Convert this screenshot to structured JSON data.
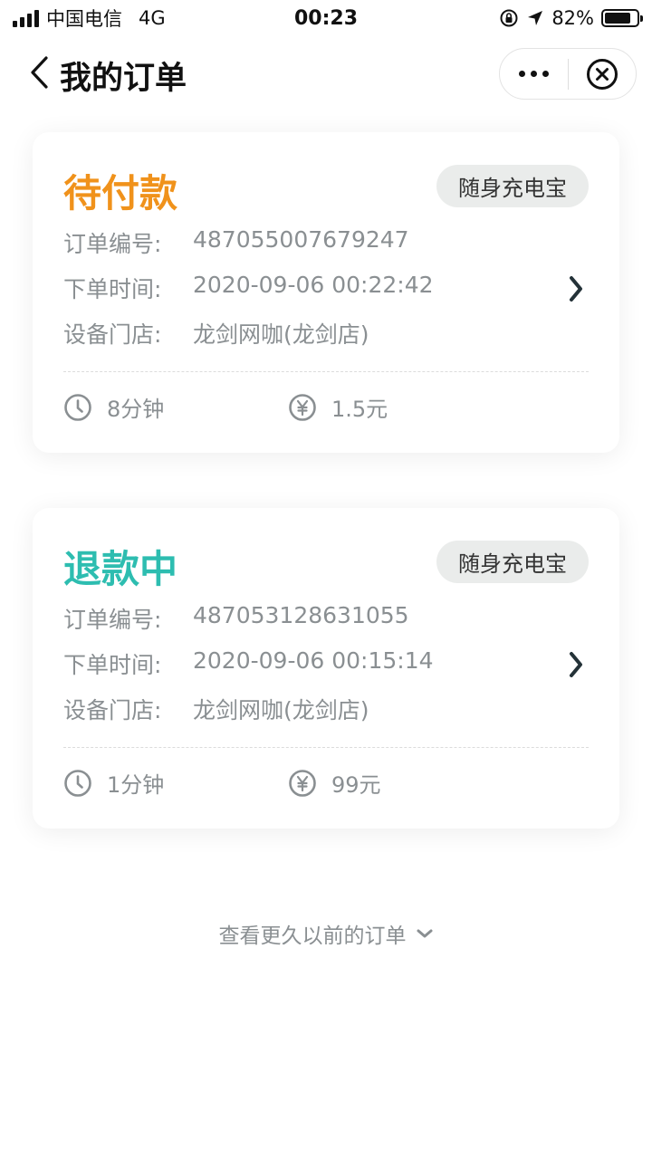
{
  "status_bar": {
    "carrier": "中国电信",
    "network": "4G",
    "time": "00:23",
    "battery": "82%",
    "battery_level": 0.82
  },
  "nav": {
    "title": "我的订单",
    "back_icon": "chevron-left-icon",
    "more_icon": "more-dots-icon",
    "close_icon": "close-circle-icon"
  },
  "labels": {
    "order_no": "订单编号:",
    "order_time": "下单时间:",
    "store": "设备门店:"
  },
  "orders": [
    {
      "status": "待付款",
      "status_color": "#f0921b",
      "tag": "随身充电宝",
      "order_no": "487055007679247",
      "order_time": "2020-09-06 00:22:42",
      "store": "龙剑网咖(龙剑店)",
      "duration": "8分钟",
      "price": "1.5元"
    },
    {
      "status": "退款中",
      "status_color": "#2dbdb0",
      "tag": "随身充电宝",
      "order_no": "487053128631055",
      "order_time": "2020-09-06 00:15:14",
      "store": "龙剑网咖(龙剑店)",
      "duration": "1分钟",
      "price": "99元"
    }
  ],
  "footer": {
    "more_orders": "查看更久以前的订单"
  }
}
